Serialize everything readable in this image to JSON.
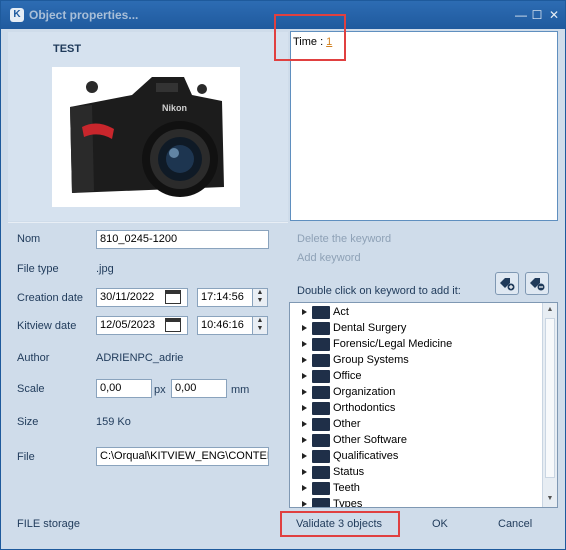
{
  "window": {
    "title": "Object properties..."
  },
  "titlebar": {
    "app_icon_label": "K",
    "minimize": "—",
    "maximize": "☐",
    "close": "✕"
  },
  "object": {
    "name": "TEST",
    "image_icon": "camera-photo"
  },
  "time_panel": {
    "label": "Time :",
    "value": "1"
  },
  "properties": {
    "nom_label": "Nom",
    "nom_value": "810_0245-1200",
    "filetype_label": "File type",
    "filetype_value": ".jpg",
    "creation_label": "Creation date",
    "creation_date": "30/11/2022",
    "creation_time": "17:14:56",
    "kitview_label": "Kitview date",
    "kitview_date": "12/05/2023",
    "kitview_time": "10:46:16",
    "author_label": "Author",
    "author_value": "ADRIENPC_adrie",
    "scale_label": "Scale",
    "scale_x": "0,00",
    "scale_unit_px": "px",
    "scale_y": "0,00",
    "scale_unit_mm": "mm",
    "size_label": "Size",
    "size_value": "159 Ko",
    "file_label": "File",
    "file_value": "C:\\Orqual\\KITVIEW_ENG\\CONTENT"
  },
  "keywords": {
    "delete_label": "Delete the keyword",
    "add_label": "Add keyword",
    "hint": "Double click on keyword to add it:",
    "add_button_icon": "add-keyword-icon",
    "remove_button_icon": "remove-keyword-icon",
    "tree": [
      "Act",
      "Dental Surgery",
      "Forensic/Legal Medicine",
      "Group Systems",
      "Office",
      "Organization",
      "Orthodontics",
      "Other",
      "Other Software",
      "Qualificatives",
      "Status",
      "Teeth",
      "Types"
    ]
  },
  "footer": {
    "storage": "FILE storage",
    "validate": "Validate 3 objects",
    "ok": "OK",
    "cancel": "Cancel"
  },
  "colors": {
    "titlebar": "#2d6cb3",
    "panel": "#cfdcea",
    "highlight": "#e04040",
    "link_disabled": "#8ea1b6"
  }
}
